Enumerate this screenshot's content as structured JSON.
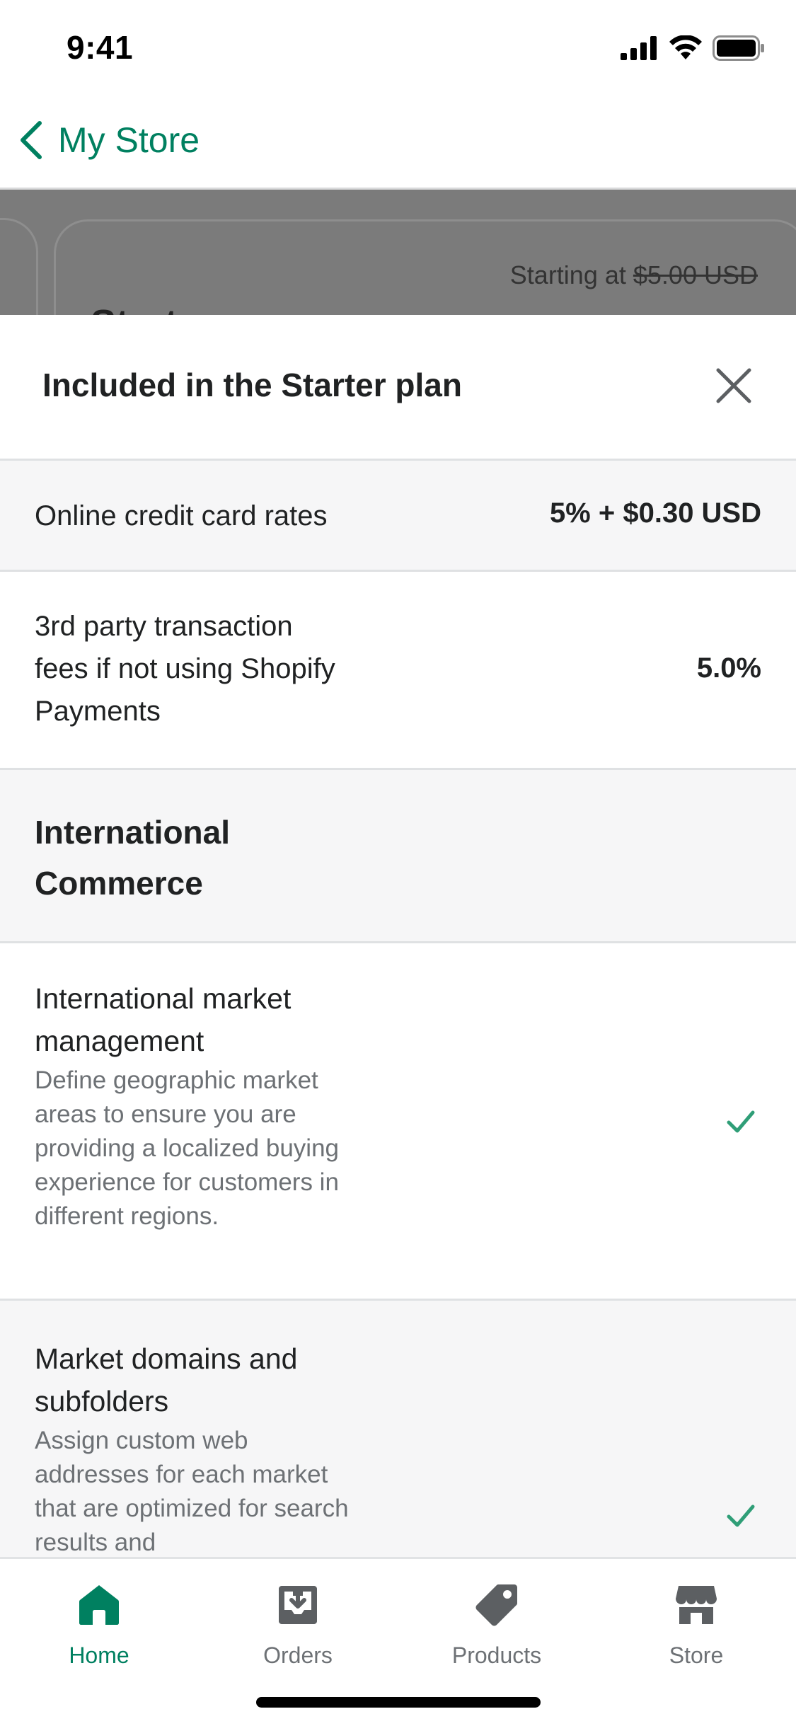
{
  "status_bar": {
    "time": "9:41"
  },
  "nav": {
    "back_label": "My Store"
  },
  "background_peek": {
    "price_prefix": "Starting at",
    "price_struck": "$5.00 USD",
    "plan_title_partial": "Start"
  },
  "sheet": {
    "title": "Included in the Starter plan",
    "rows": [
      {
        "label": "Online credit card rates",
        "value": "5% + $0.30 USD"
      },
      {
        "label": "3rd party transaction fees if not using Shopify Payments",
        "value": "5.0%"
      }
    ],
    "section_title": "International Commerce",
    "features": [
      {
        "title": "International market management",
        "description": "Define geographic market areas to ensure you are providing a localized buying experience for customers in different regions.",
        "included": true
      },
      {
        "title": "Market domains and subfolders",
        "description": "Assign custom web addresses for each market that are optimized for search results and",
        "included": true
      }
    ]
  },
  "tabs": [
    {
      "label": "Home",
      "icon": "home-icon",
      "active": true
    },
    {
      "label": "Orders",
      "icon": "orders-icon",
      "active": false
    },
    {
      "label": "Products",
      "icon": "tag-icon",
      "active": false
    },
    {
      "label": "Store",
      "icon": "store-icon",
      "active": false
    }
  ],
  "colors": {
    "accent": "#008060",
    "check": "#2f9e77",
    "text": "#202223",
    "subdued": "#6d7175",
    "row_gray": "#f6f6f7",
    "backdrop": "#7b7b7b"
  }
}
